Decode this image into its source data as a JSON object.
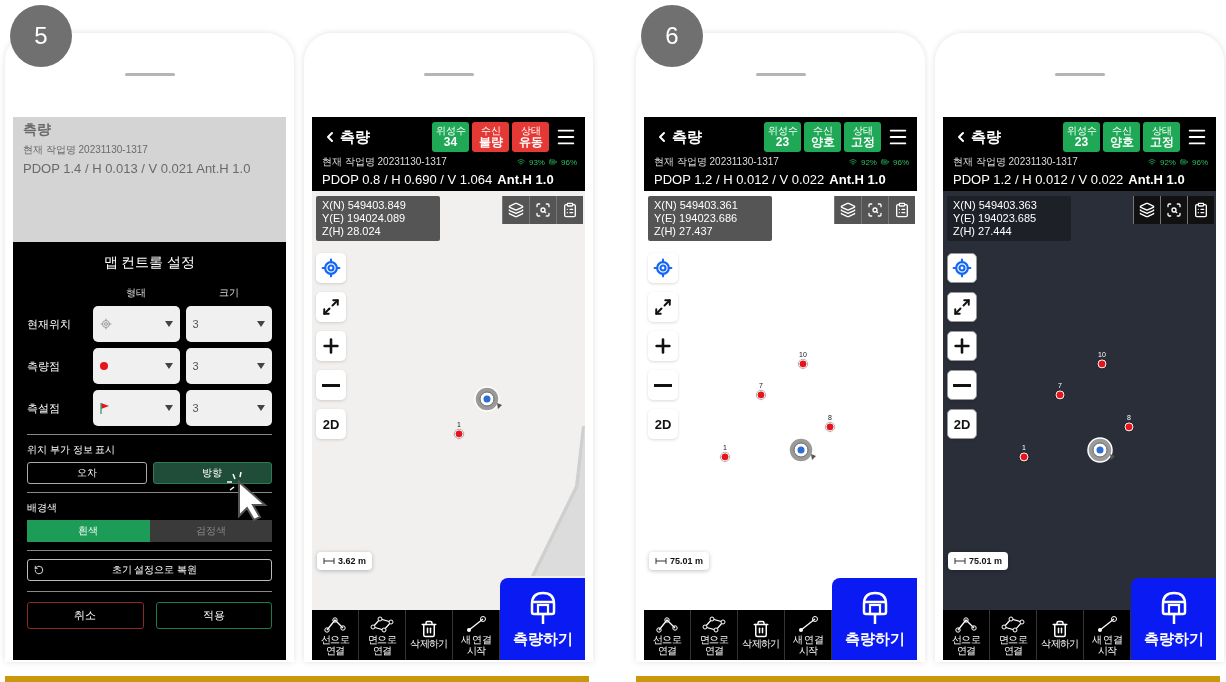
{
  "steps": [
    {
      "number": "5",
      "screens": [
        {
          "kind": "settings",
          "background": {
            "title": "측량",
            "work_name": "현재 작업명 20231130-1317",
            "pdop": "PDOP 1.4 / H 0.013 / V 0.021",
            "ant": "Ant.H 1.0"
          },
          "dialog": {
            "title": "맵 컨트롤 설정",
            "columns": [
              "형태",
              "크기"
            ],
            "rows": [
              {
                "label": "현재위치",
                "kind": "crosshair",
                "size": "3"
              },
              {
                "label": "측량점",
                "kind": "dot",
                "size": "3"
              },
              {
                "label": "측설점",
                "kind": "flag",
                "size": "3"
              }
            ],
            "info_section": {
              "label": "위치 부가 정보 표시",
              "options": [
                {
                  "label": "오차",
                  "selected": false
                },
                {
                  "label": "방향",
                  "selected": true
                }
              ]
            },
            "bg_section": {
              "label": "배경색",
              "options": [
                {
                  "label": "흰색",
                  "selected": true
                },
                {
                  "label": "검정색",
                  "selected": false
                }
              ]
            },
            "reset": "초기 설정으로 복원",
            "cancel": "취소",
            "apply": "적용"
          }
        },
        {
          "kind": "map",
          "title": "측량",
          "badges": [
            {
              "caption": "위성수",
              "value": "34",
              "color": "#1fa855"
            },
            {
              "caption": "수신",
              "value": "불량",
              "color": "#e53935"
            },
            {
              "caption": "상태",
              "value": "유동",
              "color": "#e53935"
            }
          ],
          "work_name": "현재 작업명 20231130-1317",
          "signal": "93%",
          "battery": "96%",
          "pdop": "PDOP 0.8 / H 0.690 / V 1.064",
          "ant": "Ant.H 1.0",
          "coords": [
            "X(N) 549403.849",
            "Y(E) 194024.089",
            "Z(H) 28.024"
          ],
          "map": {
            "color": "#f1f0ee",
            "road": true,
            "dark": false
          },
          "zoom_mode": "2D",
          "points": [
            {
              "label": "1"
            }
          ],
          "scale": "3.62 m",
          "tools": [
            "선으로 연결",
            "면으로 연결",
            "삭제하기",
            "새 연결 시작"
          ],
          "action": "측량하기"
        }
      ]
    },
    {
      "number": "6",
      "screens": [
        {
          "kind": "map",
          "title": "측량",
          "badges": [
            {
              "caption": "위성수",
              "value": "23",
              "color": "#1fa855"
            },
            {
              "caption": "수신",
              "value": "양호",
              "color": "#1fa855"
            },
            {
              "caption": "상태",
              "value": "고정",
              "color": "#1fa855"
            }
          ],
          "work_name": "현재 작업명 20231130-1317",
          "signal": "92%",
          "battery": "96%",
          "pdop": "PDOP 1.2 / H 0.012 / V 0.022",
          "ant": "Ant.H 1.0",
          "coords": [
            "X(N) 549403.361",
            "Y(E) 194023.686",
            "Z(H) 27.437"
          ],
          "map": {
            "color": "#ffffff",
            "road": false,
            "dark": false
          },
          "zoom_mode": "2D",
          "points": [
            {
              "label": "10"
            },
            {
              "label": "7"
            },
            {
              "label": "8"
            },
            {
              "label": "1"
            }
          ],
          "scale": "75.01 m",
          "tools": [
            "선으로 연결",
            "면으로 연결",
            "삭제하기",
            "새 연결 시작"
          ],
          "action": "측량하기"
        },
        {
          "kind": "map",
          "title": "측량",
          "badges": [
            {
              "caption": "위성수",
              "value": "23",
              "color": "#1fa855"
            },
            {
              "caption": "수신",
              "value": "양호",
              "color": "#1fa855"
            },
            {
              "caption": "상태",
              "value": "고정",
              "color": "#1fa855"
            }
          ],
          "work_name": "현재 작업명 20231130-1317",
          "signal": "92%",
          "battery": "96%",
          "pdop": "PDOP 1.2 / H 0.012 / V 0.022",
          "ant": "Ant.H 1.0",
          "coords": [
            "X(N) 549403.363",
            "Y(E) 194023.685",
            "Z(H) 27.444"
          ],
          "map": {
            "color": "#2a2e39",
            "road": false,
            "dark": true
          },
          "zoom_mode": "2D",
          "points": [
            {
              "label": "10"
            },
            {
              "label": "7"
            },
            {
              "label": "8"
            },
            {
              "label": "1"
            }
          ],
          "scale": "75.01 m",
          "tools": [
            "선으로 연결",
            "면으로 연결",
            "삭제하기",
            "새 연결 시작"
          ],
          "action": "측량하기"
        }
      ]
    }
  ]
}
